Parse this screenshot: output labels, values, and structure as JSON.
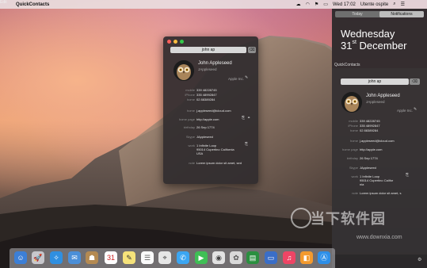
{
  "menubar": {
    "app_name": "QuickContacts",
    "clock": "Wed 17:02",
    "user": "Utente ospite"
  },
  "popup": {
    "search_value": "john ap",
    "name": "John Appleseed",
    "username": "JAppleseed",
    "apple_inc": "Apple Inc.",
    "fields": [
      {
        "label": "mobile",
        "value": "339 48228745"
      },
      {
        "label": "iPhone",
        "value": "335 48992847"
      },
      {
        "label": "home",
        "value": "02 88389284"
      },
      {
        "label": "home",
        "value": "j.appleseed@icloud.com"
      },
      {
        "label": "home page",
        "value": "http://apple.com"
      },
      {
        "label": "birthday",
        "value": "26 Sep 1774"
      },
      {
        "label": "Skype",
        "value": "JAppleseed"
      },
      {
        "label": "work",
        "value": "1 Infinite Loop"
      },
      {
        "label": "",
        "value": "95014 Cupertino California"
      },
      {
        "label": "",
        "value": "USA"
      },
      {
        "label": "note",
        "value": "Lorem ipsum dolor sit amet, sed"
      }
    ]
  },
  "notification_center": {
    "tab_today": "Today",
    "tab_notifications": "Notifications",
    "day_name": "Wednesday",
    "day_num": "31",
    "day_suffix": "st",
    "month": "December",
    "widget_title": "QuickContacts",
    "search_value": "john ap",
    "name": "John Appleseed",
    "username": "JAppleseed",
    "apple_inc": "Apple Inc.",
    "fields": [
      {
        "label": "mobile",
        "value": "339 48228745"
      },
      {
        "label": "iPhone",
        "value": "335 48992847"
      },
      {
        "label": "home",
        "value": "02 88389284"
      },
      {
        "label": "home",
        "value": "j.appleseed@icloud.com"
      },
      {
        "label": "home page",
        "value": "http://apple.com"
      },
      {
        "label": "birthday",
        "value": "26 Sep 1774"
      },
      {
        "label": "Skype",
        "value": "JAppleseed"
      },
      {
        "label": "work",
        "value": "1 Infinite Loop"
      },
      {
        "label": "",
        "value": "95014 Cupertino Califor"
      },
      {
        "label": "",
        "value": "nia"
      },
      {
        "label": "note",
        "value": "Lorem ipsum dolor sit amet, s"
      }
    ],
    "edit_label": "Edit"
  },
  "watermark": {
    "text": "当下软件园",
    "url": "www.downxia.com"
  }
}
